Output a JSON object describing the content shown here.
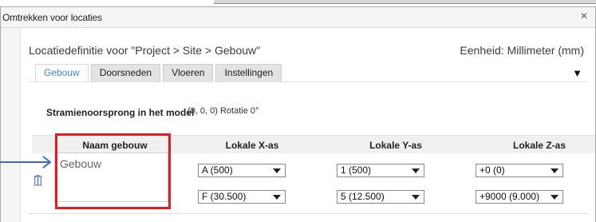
{
  "dialog": {
    "title": "Omtrekken voor locaties",
    "close_label": "×"
  },
  "header": {
    "location_definition": "Locatiedefinitie voor \"Project > Site > Gebouw\"",
    "unit": "Eenheid: Millimeter (mm)"
  },
  "tabs": [
    {
      "label": "Gebouw",
      "active": true
    },
    {
      "label": "Doorsneden",
      "active": false
    },
    {
      "label": "Vloeren",
      "active": false
    },
    {
      "label": "Instellingen",
      "active": false
    }
  ],
  "tab_menu_arrow": "▼",
  "origin": {
    "label": "Stramienoorsprong in het model",
    "value": "(0, 0, 0)  Rotatie 0°"
  },
  "grid": {
    "columns": [
      "Naam gebouw",
      "Lokale X-as",
      "Lokale Y-as",
      "Lokale Z-as"
    ],
    "row": {
      "name": "Gebouw",
      "x_from": "A (500)",
      "x_to": "F (30.500)",
      "y_from": "1 (500)",
      "y_to": "5 (12.500)",
      "z_from": "+0 (0)",
      "z_to": "+9000 (9.000)"
    }
  },
  "colors": {
    "highlight": "#e01c24",
    "active_tab_text": "#3a8fd6",
    "callout_arrow": "#3a6fb4"
  },
  "icons": {
    "building": "building-icon",
    "close": "close-icon",
    "callout": "callout-arrow-icon"
  }
}
